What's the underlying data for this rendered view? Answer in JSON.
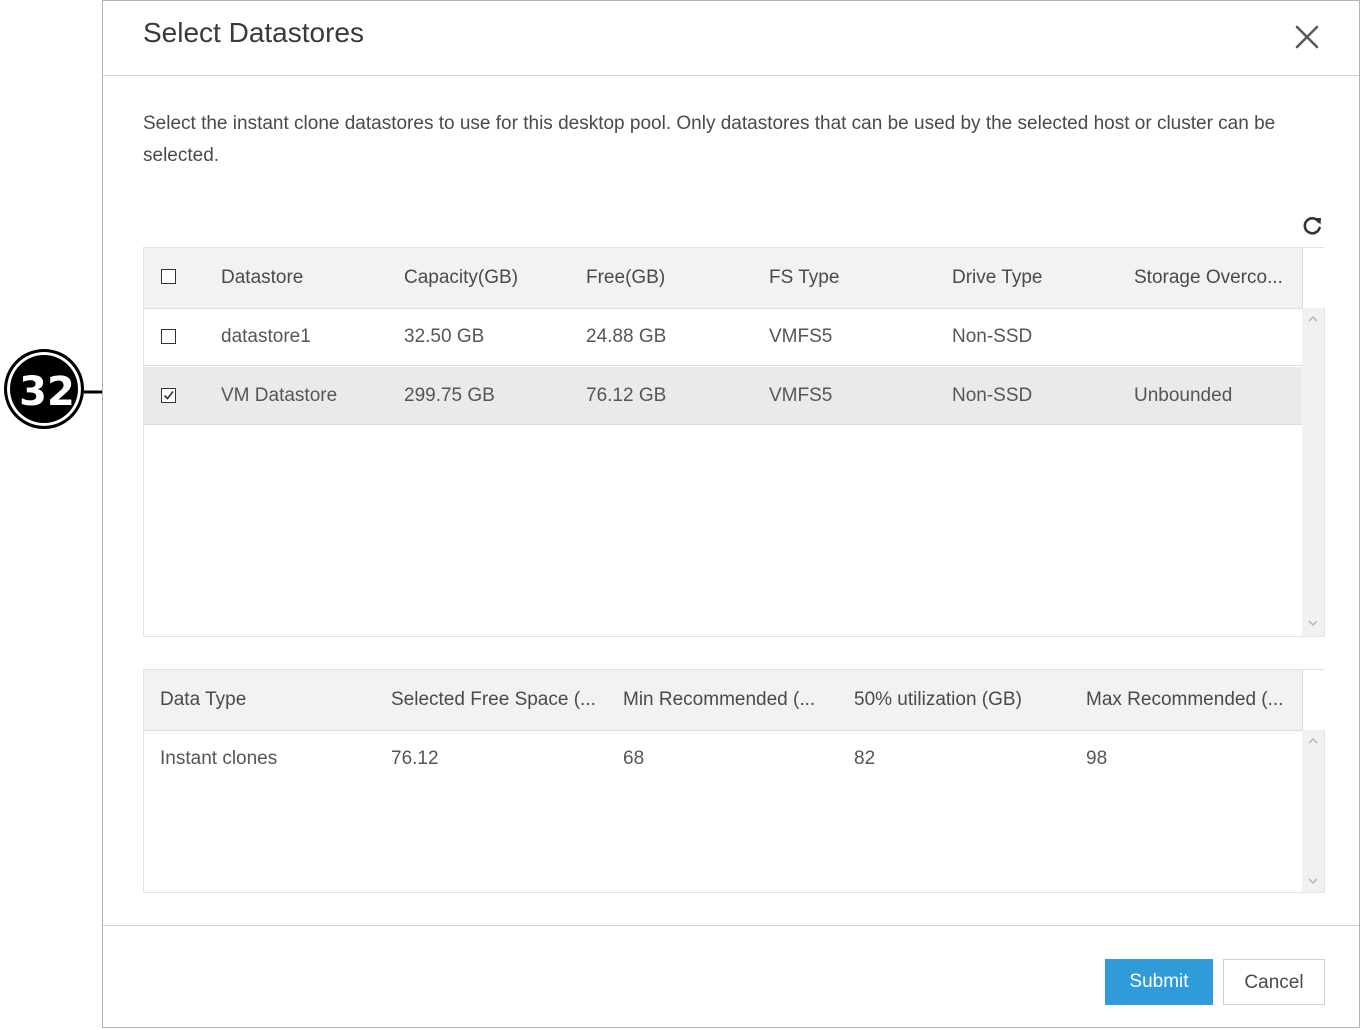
{
  "callout": {
    "number": "32"
  },
  "dialog": {
    "title": "Select Datastores",
    "description": "Select the instant clone datastores to use for this desktop pool. Only datastores that can be used by the selected host or cluster can be selected."
  },
  "datastores_table": {
    "columns": [
      "Datastore",
      "Capacity(GB)",
      "Free(GB)",
      "FS Type",
      "Drive Type",
      "Storage Overco..."
    ],
    "rows": [
      {
        "checked": false,
        "datastore": "datastore1",
        "capacity": "32.50 GB",
        "free": "24.88 GB",
        "fs_type": "VMFS5",
        "drive_type": "Non-SSD",
        "storage_overcommit": ""
      },
      {
        "checked": true,
        "datastore": "VM Datastore",
        "capacity": "299.75 GB",
        "free": "76.12 GB",
        "fs_type": "VMFS5",
        "drive_type": "Non-SSD",
        "storage_overcommit": "Unbounded"
      }
    ]
  },
  "summary_table": {
    "columns": [
      "Data Type",
      "Selected Free Space (...",
      "Min Recommended (...",
      "50% utilization (GB)",
      "Max Recommended (..."
    ],
    "rows": [
      {
        "data_type": "Instant clones",
        "selected_free_space": "76.12",
        "min_recommended": "68",
        "utilization_50": "82",
        "max_recommended": "98"
      }
    ]
  },
  "footer": {
    "submit_label": "Submit",
    "cancel_label": "Cancel"
  },
  "colors": {
    "primary_button": "#2f9bd8",
    "selected_row": "#e9eaeb",
    "header_bg": "#f2f2f2"
  },
  "icons": {
    "close": "close-icon",
    "refresh": "refresh-icon",
    "checkbox": "checkbox"
  }
}
